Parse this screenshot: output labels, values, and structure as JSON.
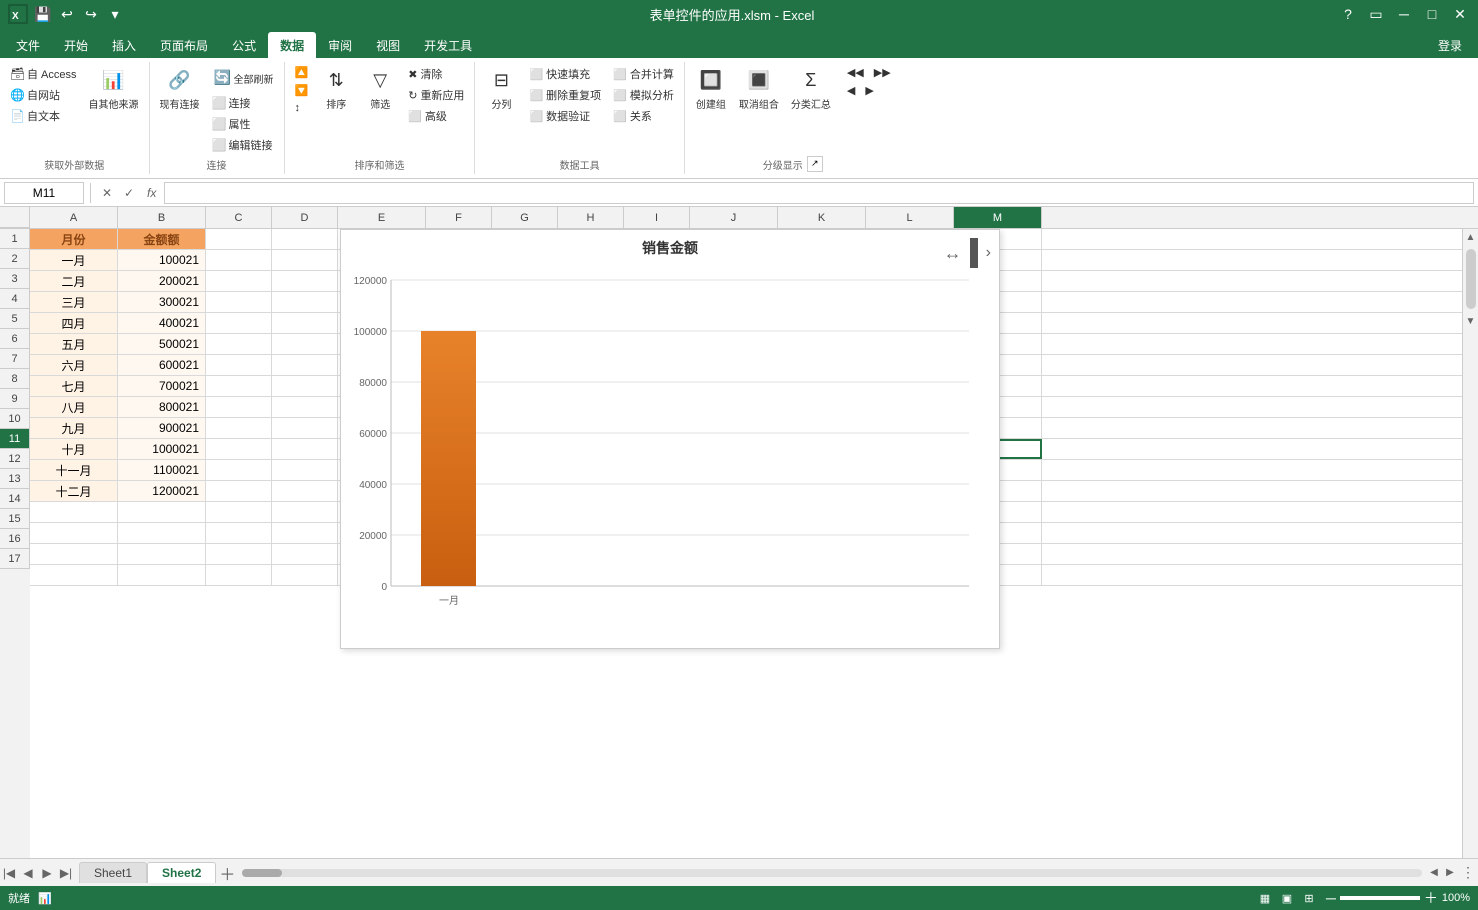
{
  "titleBar": {
    "title": "表单控件的应用.xlsm - Excel",
    "quickAccess": [
      "save",
      "undo",
      "redo",
      "customize"
    ]
  },
  "ribbonTabs": [
    {
      "id": "file",
      "label": "文件"
    },
    {
      "id": "home",
      "label": "开始"
    },
    {
      "id": "insert",
      "label": "插入"
    },
    {
      "id": "pageLayout",
      "label": "页面布局"
    },
    {
      "id": "formulas",
      "label": "公式"
    },
    {
      "id": "data",
      "label": "数据",
      "active": true
    },
    {
      "id": "review",
      "label": "审阅"
    },
    {
      "id": "view",
      "label": "视图"
    },
    {
      "id": "developer",
      "label": "开发工具"
    },
    {
      "id": "account",
      "label": "登录"
    }
  ],
  "ribbonGroups": {
    "getExternalData": {
      "label": "获取外部数据",
      "items": [
        {
          "id": "access",
          "icon": "🗃",
          "label": "自 Access"
        },
        {
          "id": "web",
          "icon": "🌐",
          "label": "自网站"
        },
        {
          "id": "text",
          "icon": "📄",
          "label": "自文本"
        },
        {
          "id": "other",
          "icon": "📊",
          "label": "自其他来源"
        }
      ]
    },
    "connections": {
      "label": "连接",
      "items": [
        {
          "id": "existing",
          "icon": "🔗",
          "label": "现有连接"
        },
        {
          "id": "refresh",
          "icon": "🔄",
          "label": "全部刷新"
        },
        {
          "id": "connect",
          "label": "连接"
        },
        {
          "id": "props",
          "label": "属性"
        },
        {
          "id": "editlinks",
          "label": "编辑链接"
        }
      ]
    },
    "sortFilter": {
      "label": "排序和筛选",
      "items": [
        {
          "id": "sortasc",
          "icon": "↑",
          "label": ""
        },
        {
          "id": "sortdesc",
          "icon": "↓",
          "label": ""
        },
        {
          "id": "sort",
          "icon": "↕",
          "label": "排序"
        },
        {
          "id": "filter",
          "icon": "▽",
          "label": "筛选"
        },
        {
          "id": "clear",
          "label": "清除"
        },
        {
          "id": "reapply",
          "label": "重新应用"
        },
        {
          "id": "advanced",
          "label": "高级"
        }
      ]
    },
    "dataTools": {
      "label": "数据工具",
      "items": [
        {
          "id": "split",
          "icon": "⊟",
          "label": "分列"
        },
        {
          "id": "quickfill",
          "label": "快速填充"
        },
        {
          "id": "removedup",
          "label": "删除重复项"
        },
        {
          "id": "validate",
          "label": "数据验证"
        },
        {
          "id": "consolidate",
          "label": "合并计算"
        },
        {
          "id": "whatif",
          "label": "模拟分析"
        },
        {
          "id": "relationship",
          "label": "关系"
        }
      ]
    },
    "outline": {
      "label": "分级显示",
      "items": [
        {
          "id": "group",
          "label": "创建组"
        },
        {
          "id": "ungroup",
          "label": "取消组合"
        },
        {
          "id": "subtotal",
          "label": "分类汇总"
        }
      ]
    }
  },
  "formulaBar": {
    "cellRef": "M11",
    "formula": ""
  },
  "columns": {
    "headers": [
      "A",
      "B",
      "C",
      "D",
      "E",
      "F",
      "G",
      "H",
      "I",
      "J",
      "K",
      "L",
      "M"
    ],
    "widths": [
      88,
      88,
      66,
      66,
      88,
      66,
      66,
      66,
      66,
      88,
      88,
      88,
      88
    ]
  },
  "rows": {
    "count": 17,
    "headers": [
      "1",
      "2",
      "3",
      "4",
      "5",
      "6",
      "7",
      "8",
      "9",
      "10",
      "11",
      "12",
      "13",
      "14",
      "15",
      "16",
      "17"
    ]
  },
  "cellData": {
    "A1": {
      "value": "月份",
      "type": "header"
    },
    "B1": {
      "value": "金额额",
      "type": "header"
    },
    "A2": {
      "value": "一月",
      "type": "data"
    },
    "B2": {
      "value": "100021",
      "type": "number"
    },
    "A3": {
      "value": "二月",
      "type": "data"
    },
    "B3": {
      "value": "200021",
      "type": "number"
    },
    "A4": {
      "value": "三月",
      "type": "data"
    },
    "B4": {
      "value": "300021",
      "type": "number"
    },
    "A5": {
      "value": "四月",
      "type": "data"
    },
    "B5": {
      "value": "400021",
      "type": "number"
    },
    "A6": {
      "value": "五月",
      "type": "data"
    },
    "B6": {
      "value": "500021",
      "type": "number"
    },
    "A7": {
      "value": "六月",
      "type": "data"
    },
    "B7": {
      "value": "600021",
      "type": "number"
    },
    "A8": {
      "value": "七月",
      "type": "data"
    },
    "B8": {
      "value": "700021",
      "type": "number"
    },
    "A9": {
      "value": "八月",
      "type": "data"
    },
    "B9": {
      "value": "800021",
      "type": "number"
    },
    "A10": {
      "value": "九月",
      "type": "data"
    },
    "B10": {
      "value": "900021",
      "type": "number"
    },
    "A11": {
      "value": "十月",
      "type": "data"
    },
    "B11": {
      "value": "1000021",
      "type": "number"
    },
    "A12": {
      "value": "十一月",
      "type": "data"
    },
    "B12": {
      "value": "1100021",
      "type": "number"
    },
    "A13": {
      "value": "十二月",
      "type": "data"
    },
    "B13": {
      "value": "1200021",
      "type": "number"
    }
  },
  "chart": {
    "title": "销售金额",
    "yAxisLabels": [
      "0",
      "20000",
      "40000",
      "60000",
      "80000",
      "100000",
      "120000"
    ],
    "bars": [
      {
        "label": "一月",
        "value": 100021,
        "maxValue": 120000
      }
    ],
    "selectedBar": "一月"
  },
  "sheets": [
    {
      "id": "sheet1",
      "label": "Sheet1",
      "active": false
    },
    {
      "id": "sheet2",
      "label": "Sheet2",
      "active": true
    }
  ],
  "statusBar": {
    "status": "就绪",
    "zoom": "100%",
    "icon": "📊"
  }
}
